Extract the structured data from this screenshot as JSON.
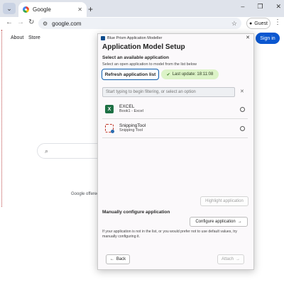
{
  "browser": {
    "tab_title": "Google",
    "tab_close": "✕",
    "new_tab": "+",
    "url": "google.com",
    "profile_label": "Guest",
    "tab_menu": "⌄",
    "controls": [
      "–",
      "❐",
      "✕"
    ]
  },
  "google": {
    "nav": [
      "About",
      "Store"
    ],
    "signin_label": "Sign in",
    "offered_text": "Google offered"
  },
  "dialog": {
    "window_title": "Blue Prism Application Modeller",
    "close": "✕",
    "heading": "Application Model Setup",
    "select_section_label": "Select an available application",
    "select_hint": "Select an open application to model from the list below",
    "refresh_label": "Refresh application list",
    "last_update": "Last update: 18:11:08",
    "filter_placeholder": "Start typing to begin filtering, or select an option",
    "filter_clear": "✕",
    "apps": [
      {
        "name": "EXCEL",
        "subtitle": "Book1 - Excel",
        "icon": "excel-icon"
      },
      {
        "name": "SnippingTool",
        "subtitle": "Snipping Tool",
        "icon": "snipping-tool-icon"
      }
    ],
    "highlight_label": "Highlight application",
    "manual_section_label": "Manually configure application",
    "configure_label": "Configure application",
    "help_text": "If your application is not in the list, or you would prefer not to use default values, try manually configuring it.",
    "back_label": "Back",
    "attach_label": "Attach"
  },
  "colors": {
    "accent": "#0b57d0",
    "badge_bg": "#dcf3c7",
    "excel_green": "#1d7044"
  }
}
